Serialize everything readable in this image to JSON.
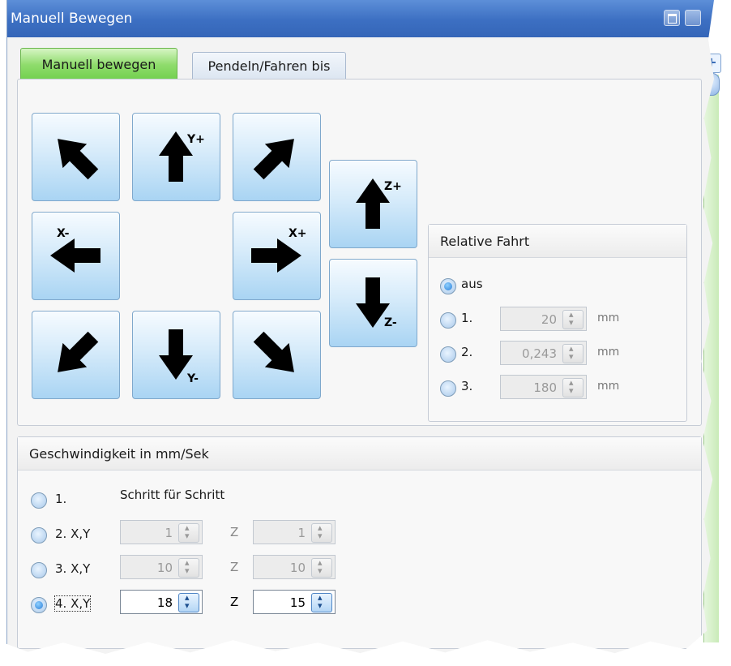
{
  "window": {
    "title": "Manuell Bewegen"
  },
  "icons": {
    "minimize": "window-minimize-icon",
    "pin": "pin-icon",
    "side_plus": "plus-icon"
  },
  "tabs": [
    {
      "label": "Manuell bewegen",
      "active": true
    },
    {
      "label": "Pendeln/Fahren bis",
      "active": false
    }
  ],
  "jog": {
    "yplus": "Y+",
    "yminus": "Y-",
    "xplus": "X+",
    "xminus": "X-",
    "zplus": "Z+",
    "zminus": "Z-"
  },
  "relative": {
    "title": "Relative Fahrt",
    "options": [
      {
        "label": "aus",
        "checked": true
      },
      {
        "label": "1.",
        "value": "20",
        "unit": "mm",
        "checked": false
      },
      {
        "label": "2.",
        "value": "0,243",
        "unit": "mm",
        "checked": false
      },
      {
        "label": "3.",
        "value": "180",
        "unit": "mm",
        "checked": false
      }
    ]
  },
  "speed": {
    "title": "Geschwindigkeit in mm/Sek",
    "step_label": "Schritt für Schritt",
    "z_label": "Z",
    "rows": [
      {
        "label": "1.",
        "checked": false
      },
      {
        "label": "2. X,Y",
        "xy": "1",
        "z": "1",
        "checked": false
      },
      {
        "label": "3. X,Y",
        "xy": "10",
        "z": "10",
        "checked": false
      },
      {
        "label": "4. X,Y",
        "xy": "18",
        "z": "15",
        "checked": true
      }
    ]
  },
  "colors": {
    "titlebar": "#3c6fc2",
    "active_tab": "#8fdc6c",
    "button_blue": "#a9d4f3"
  }
}
